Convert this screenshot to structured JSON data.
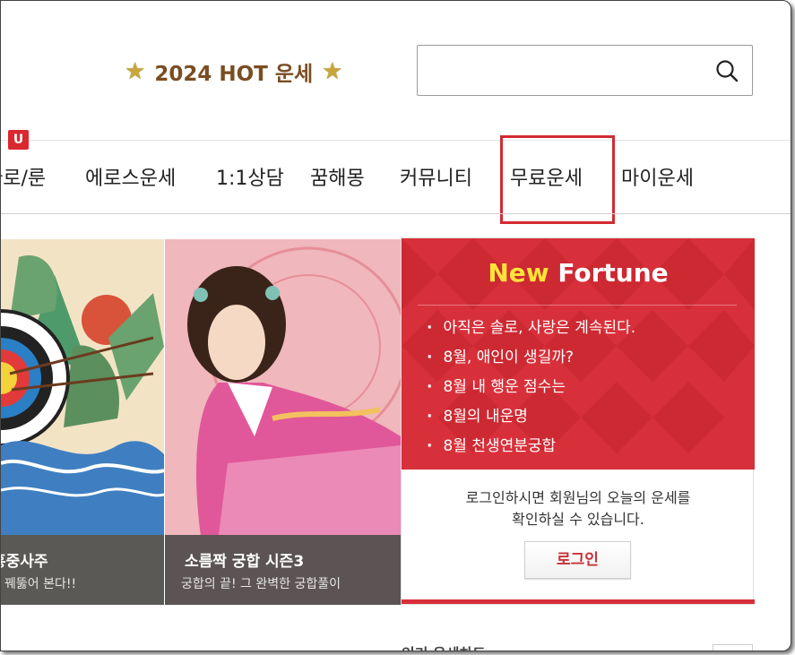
{
  "header": {
    "promo_text": "2024 HOT 운세",
    "star_left": "★",
    "star_right": "★",
    "search": {
      "value": "",
      "placeholder": ""
    }
  },
  "nav": {
    "badge": "U",
    "items": [
      {
        "label": "타로/룬"
      },
      {
        "label": "에로스운세"
      },
      {
        "label": "1:1상담"
      },
      {
        "label": "꿈해몽"
      },
      {
        "label": "커뮤니티"
      },
      {
        "label": "무료운세",
        "highlighted": true
      },
      {
        "label": "마이운세"
      }
    ]
  },
  "banner": {
    "left": {
      "title": "홍중사주",
      "subtitle": "꿰뚫어 본다!!"
    },
    "middle": {
      "title": "소름짝 궁합 시즌3",
      "subtitle": "궁합의 끝! 그 완벽한 궁합풀이"
    },
    "fortune": {
      "title_new": "New",
      "title_fortune": "Fortune",
      "items": [
        "아직은 솔로, 사랑은 계속된다.",
        "8월, 애인이 생길까?",
        "8월 내 행운 점수는",
        "8월의 내운명",
        "8월 천생연분궁합"
      ],
      "login_message_1": "로그인하시면 회원님의 오늘의 운세를",
      "login_message_2": "확인하실 수 있습니다.",
      "login_button": "로그인"
    }
  },
  "bottom": {
    "section_title": "인기 운세차트"
  },
  "colors": {
    "accent_red": "#d8303a",
    "highlight_border": "#d22a30",
    "promo_brown": "#7a4d22"
  }
}
